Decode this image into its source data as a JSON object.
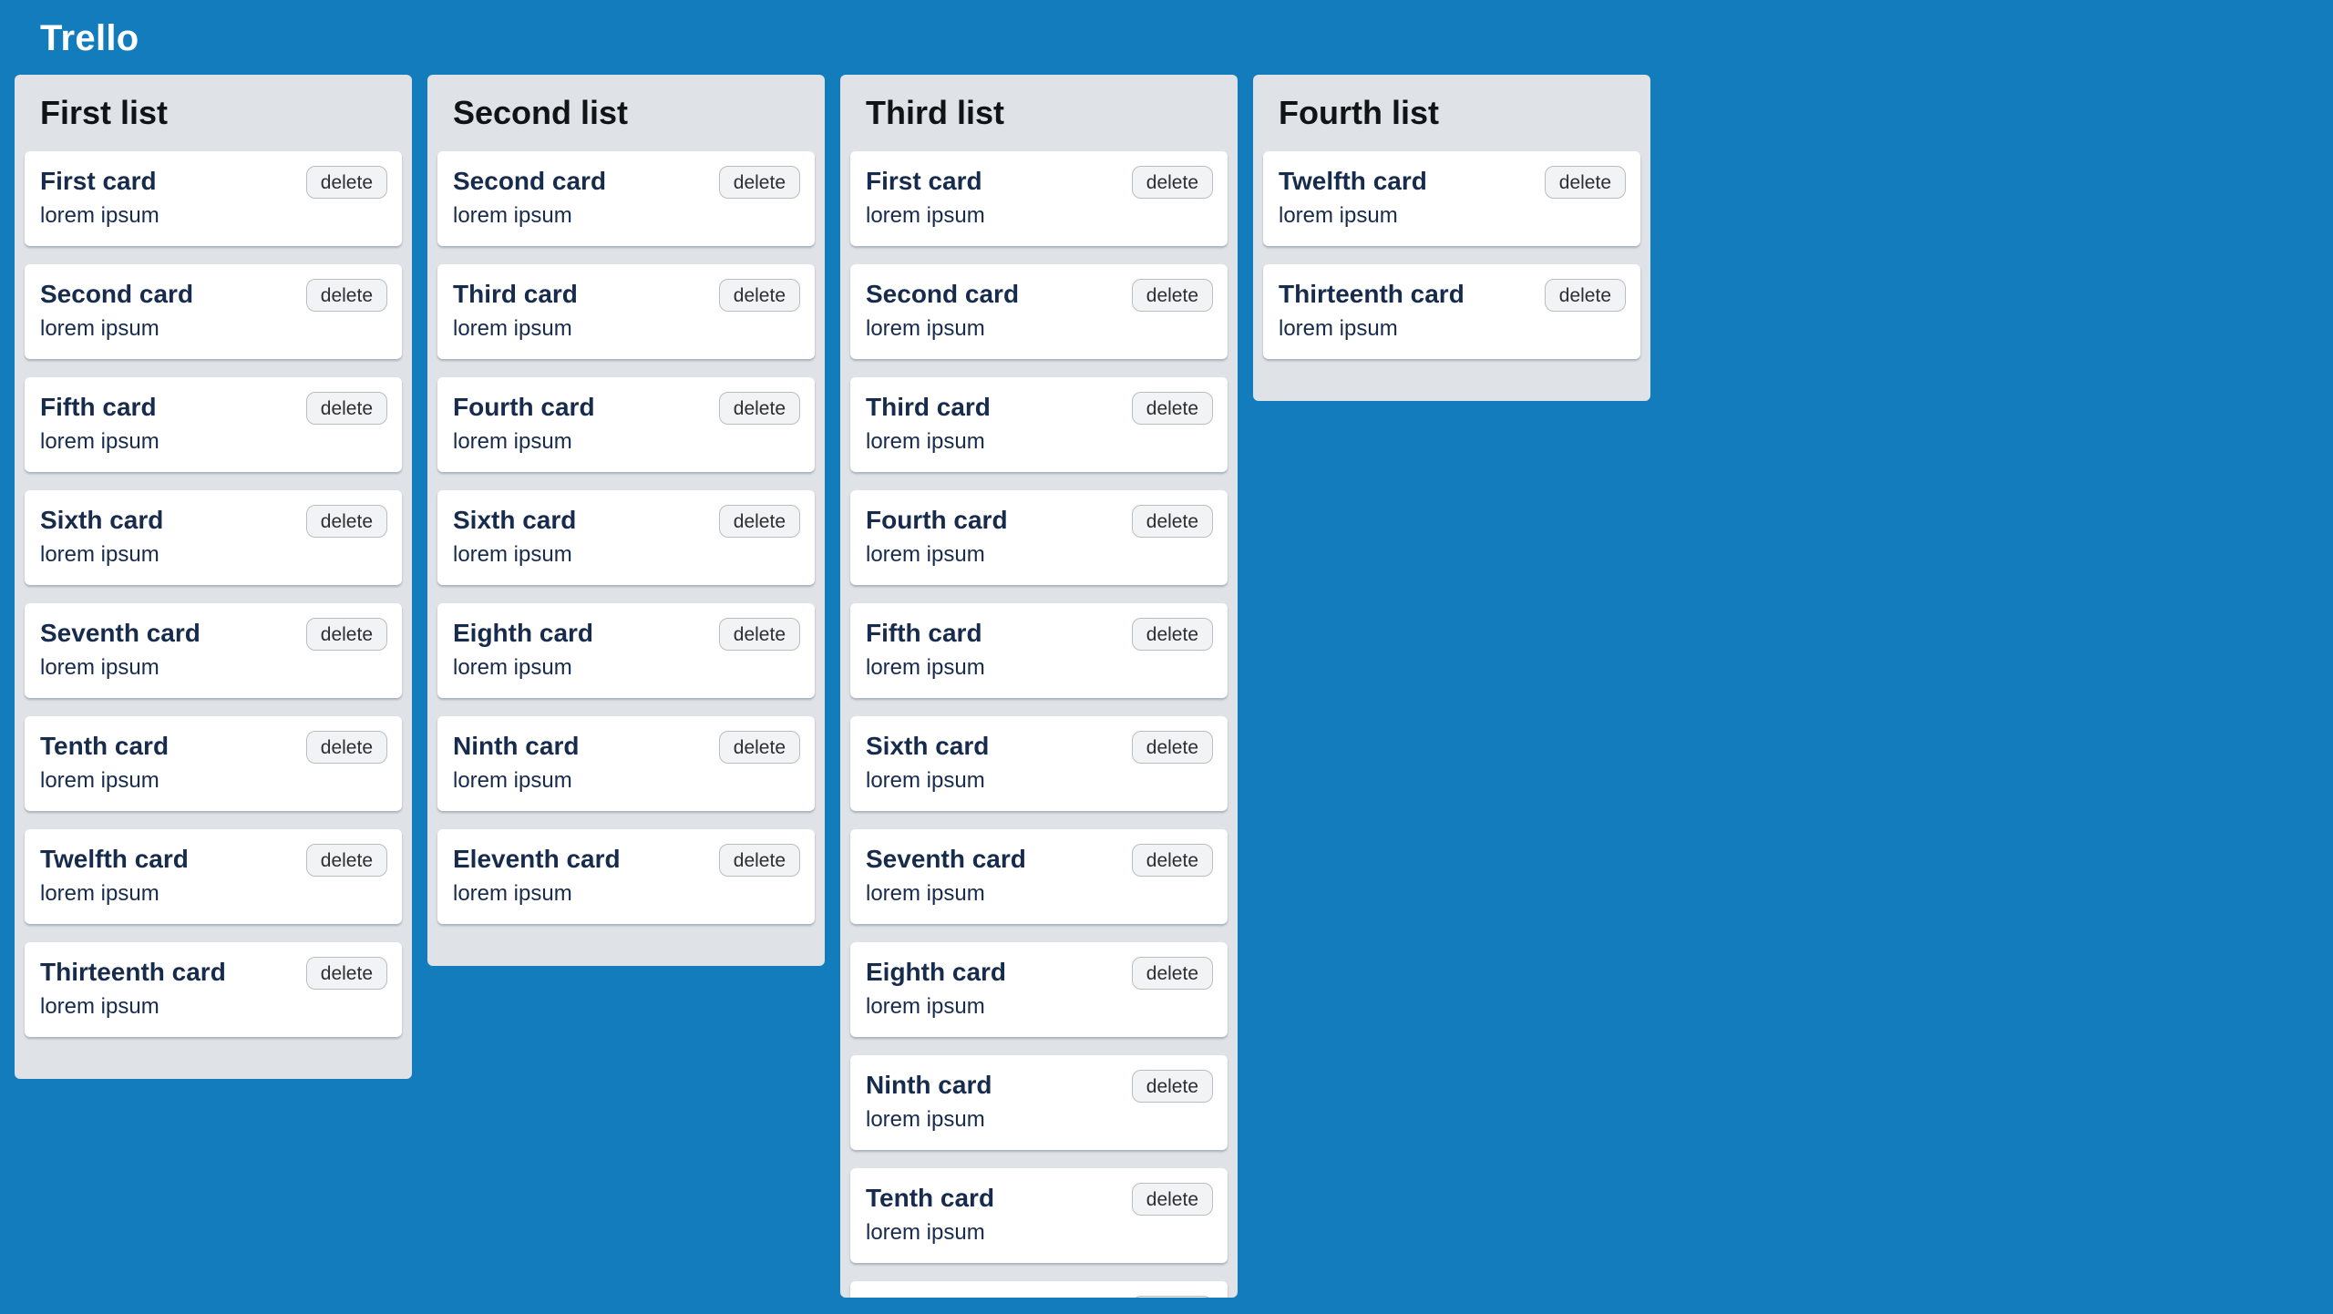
{
  "app": {
    "title": "Trello"
  },
  "colors": {
    "background": "#137cbd",
    "list_background": "#dfe2e6",
    "card_background": "#ffffff",
    "card_text": "#172b4d"
  },
  "delete_label": "delete",
  "lists": [
    {
      "title": "First list",
      "cards": [
        {
          "title": "First card",
          "text": "lorem ipsum"
        },
        {
          "title": "Second card",
          "text": "lorem ipsum"
        },
        {
          "title": "Fifth card",
          "text": "lorem ipsum"
        },
        {
          "title": "Sixth card",
          "text": "lorem ipsum"
        },
        {
          "title": "Seventh card",
          "text": "lorem ipsum"
        },
        {
          "title": "Tenth card",
          "text": "lorem ipsum"
        },
        {
          "title": "Twelfth card",
          "text": "lorem ipsum"
        },
        {
          "title": "Thirteenth card",
          "text": "lorem ipsum"
        }
      ]
    },
    {
      "title": "Second list",
      "cards": [
        {
          "title": "Second card",
          "text": "lorem ipsum"
        },
        {
          "title": "Third card",
          "text": "lorem ipsum"
        },
        {
          "title": "Fourth card",
          "text": "lorem ipsum"
        },
        {
          "title": "Sixth card",
          "text": "lorem ipsum"
        },
        {
          "title": "Eighth card",
          "text": "lorem ipsum"
        },
        {
          "title": "Ninth card",
          "text": "lorem ipsum"
        },
        {
          "title": "Eleventh card",
          "text": "lorem ipsum"
        }
      ]
    },
    {
      "title": "Third list",
      "clipped": true,
      "cards": [
        {
          "title": "First card",
          "text": "lorem ipsum"
        },
        {
          "title": "Second card",
          "text": "lorem ipsum"
        },
        {
          "title": "Third card",
          "text": "lorem ipsum"
        },
        {
          "title": "Fourth card",
          "text": "lorem ipsum"
        },
        {
          "title": "Fifth card",
          "text": "lorem ipsum"
        },
        {
          "title": "Sixth card",
          "text": "lorem ipsum"
        },
        {
          "title": "Seventh card",
          "text": "lorem ipsum"
        },
        {
          "title": "Eighth card",
          "text": "lorem ipsum"
        },
        {
          "title": "Ninth card",
          "text": "lorem ipsum"
        },
        {
          "title": "Tenth card",
          "text": "lorem ipsum"
        },
        {
          "title": "",
          "text": ""
        }
      ]
    },
    {
      "title": "Fourth list",
      "cards": [
        {
          "title": "Twelfth card",
          "text": "lorem ipsum"
        },
        {
          "title": "Thirteenth card",
          "text": "lorem ipsum"
        }
      ]
    }
  ]
}
